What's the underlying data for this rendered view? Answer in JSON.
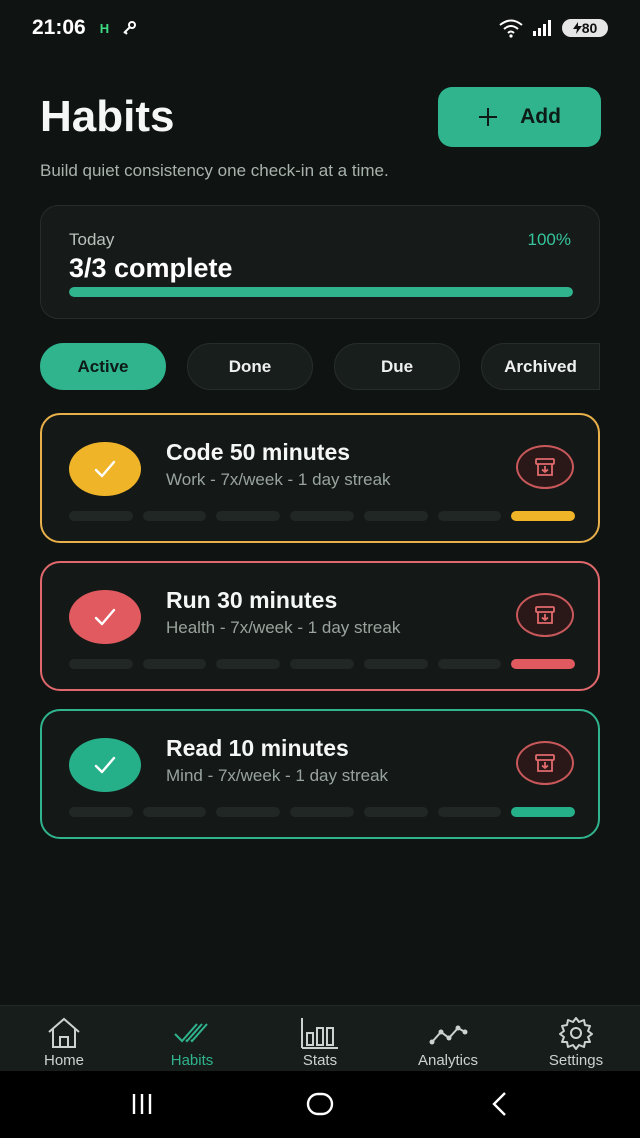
{
  "status_bar": {
    "time": "21:06",
    "carrier_letter": "H",
    "battery": "80"
  },
  "header": {
    "title": "Habits",
    "add_label": "Add",
    "subtitle": "Build quiet consistency one check-in at a time."
  },
  "today": {
    "label": "Today",
    "value": "3/3 complete",
    "percent_text": "100%",
    "progress": 1.0
  },
  "filters": [
    {
      "label": "Active",
      "active": true
    },
    {
      "label": "Done",
      "active": false
    },
    {
      "label": "Due",
      "active": false
    },
    {
      "label": "Archived",
      "active": false
    }
  ],
  "habits": [
    {
      "name": "Code 50 minutes",
      "meta": "Work - 7x/week - 1 day streak",
      "color": "#f0b429",
      "border": "#e8b04a",
      "done_days": 1,
      "total_days": 7
    },
    {
      "name": "Run 30 minutes",
      "meta": "Health - 7x/week - 1 day streak",
      "color": "#e05a5f",
      "border": "#e0686c",
      "done_days": 1,
      "total_days": 7
    },
    {
      "name": "Read 10 minutes",
      "meta": "Mind - 7x/week - 1 day streak",
      "color": "#26b08a",
      "border": "#2fb48e",
      "done_days": 1,
      "total_days": 7
    }
  ],
  "bottom_nav": [
    {
      "label": "Home",
      "icon": "home-icon",
      "active": false
    },
    {
      "label": "Habits",
      "icon": "double-check-icon",
      "active": true
    },
    {
      "label": "Stats",
      "icon": "bar-chart-icon",
      "active": false
    },
    {
      "label": "Analytics",
      "icon": "trend-line-icon",
      "active": false
    },
    {
      "label": "Settings",
      "icon": "gear-icon",
      "active": false
    }
  ],
  "colors": {
    "accent": "#2fb48e",
    "background": "#0f1311",
    "archive": "#c8585a"
  }
}
